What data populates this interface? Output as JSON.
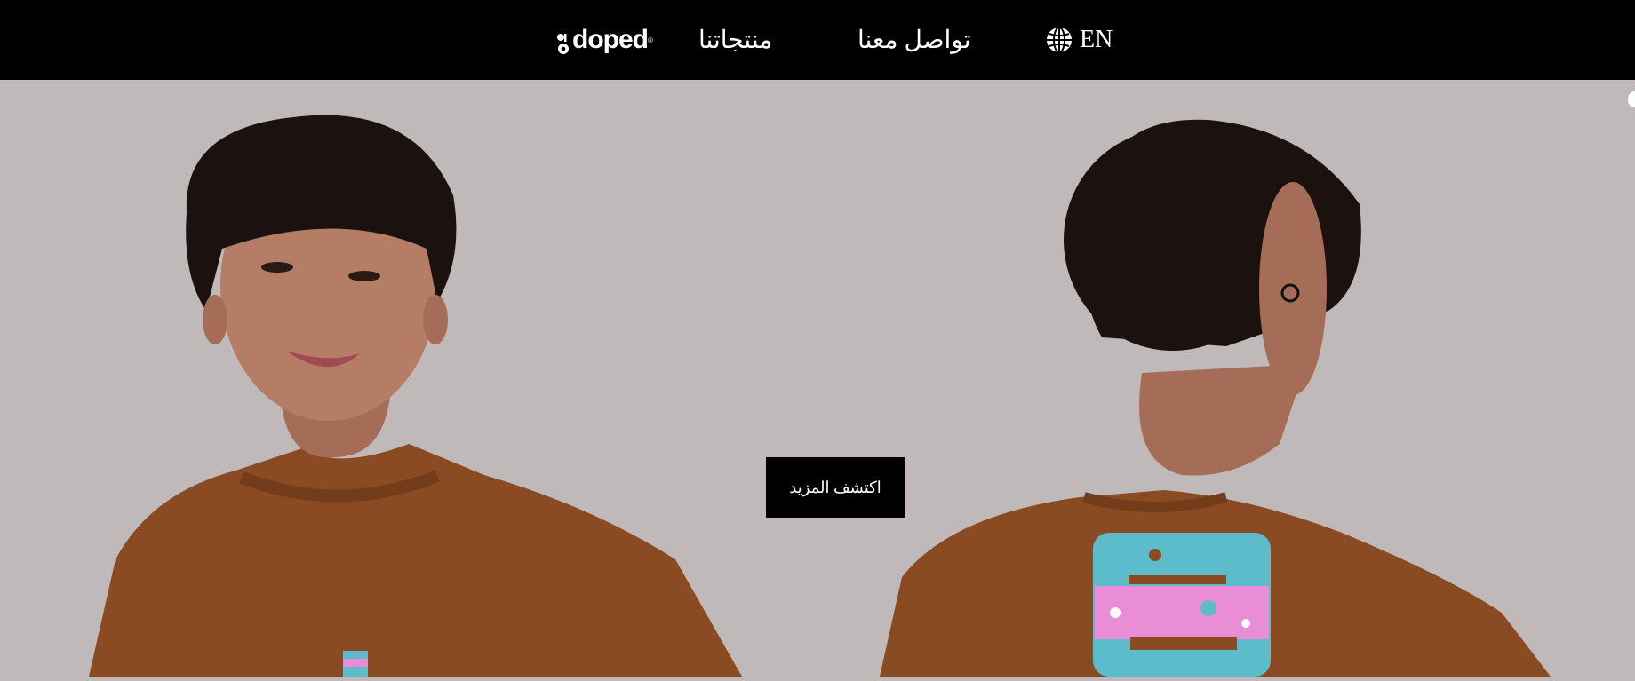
{
  "header": {
    "logo_text": "doped",
    "logo_sup": "®",
    "nav": {
      "products": "منتجاتنا",
      "contact": "تواصل معنا"
    },
    "language": "EN",
    "globe_icon": "globe-icon"
  },
  "hero": {
    "cta_label": "اكتشف المزيد",
    "product_color": "#8a4a22",
    "background_color": "#bfb9ba",
    "print_colors": [
      "#5cbccc",
      "#e98ed6"
    ]
  }
}
